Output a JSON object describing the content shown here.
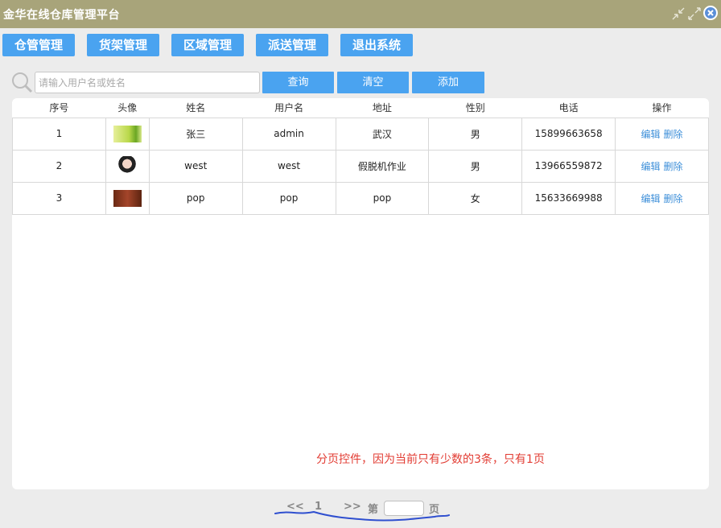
{
  "window": {
    "title": "金华在线仓库管理平台"
  },
  "nav": {
    "items": [
      "仓管管理",
      "货架管理",
      "区域管理",
      "派送管理",
      "退出系统"
    ]
  },
  "search": {
    "placeholder": "请输入用户名或姓名",
    "value": "",
    "query_label": "查询",
    "clear_label": "清空",
    "add_label": "添加"
  },
  "table": {
    "headers": [
      "序号",
      "头像",
      "姓名",
      "用户名",
      "地址",
      "性别",
      "电话",
      "操作"
    ],
    "rows": [
      {
        "seq": "1",
        "name": "张三",
        "username": "admin",
        "address": "武汉",
        "gender": "男",
        "phone": "15899663658",
        "edit": "编辑",
        "delete": "删除"
      },
      {
        "seq": "2",
        "name": "west",
        "username": "west",
        "address": "假脱机作业",
        "gender": "男",
        "phone": "13966559872",
        "edit": "编辑",
        "delete": "删除"
      },
      {
        "seq": "3",
        "name": "pop",
        "username": "pop",
        "address": "pop",
        "gender": "女",
        "phone": "15633669988",
        "edit": "编辑",
        "delete": "删除"
      }
    ]
  },
  "annotation": "分页控件，因为当前只有少数的3条，只有1页",
  "pager": {
    "prev": "<<",
    "current": "1",
    "next": ">>",
    "goto_prefix": "第",
    "goto_suffix": "页",
    "goto_value": ""
  },
  "colors": {
    "titlebar": "#a8a47a",
    "accent": "#4aa3f0",
    "link": "#3d8fd9",
    "annotation": "#e23b32",
    "underline": "#2f4fcf"
  }
}
